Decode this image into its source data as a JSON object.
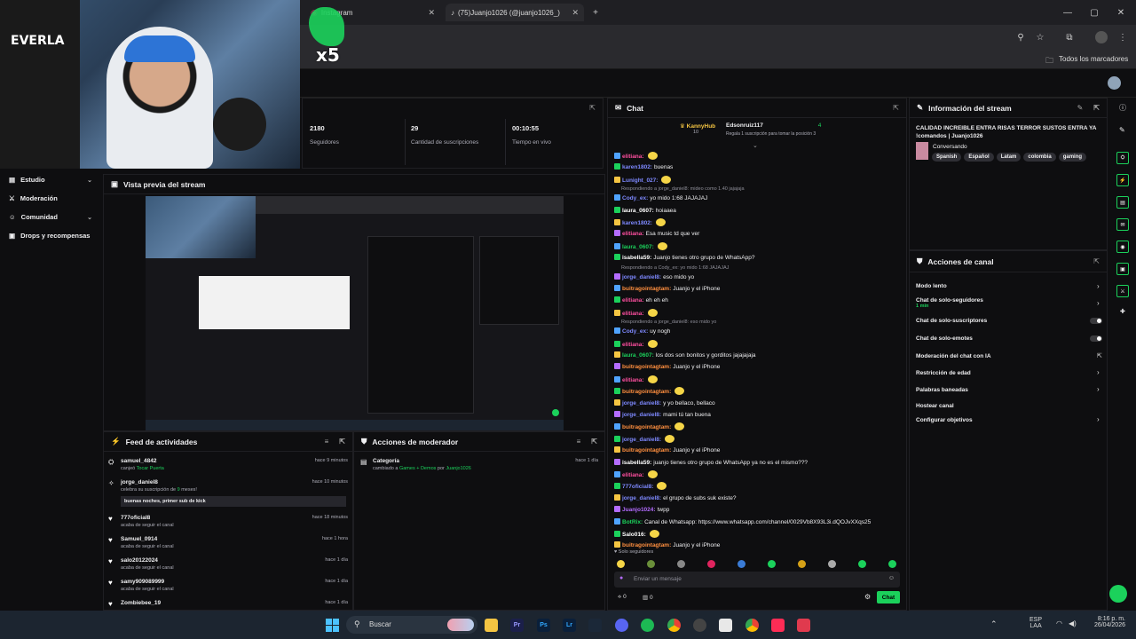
{
  "browser": {
    "tab1_title": "Instagram",
    "tab2_title": "(75)Juanjo1026 (@juanjo1026_)",
    "bookmarks_label": "Todos los marcadores"
  },
  "overlay": {
    "multiplier": "x5",
    "bag_text": "EVERLA"
  },
  "left_nav": {
    "items": [
      {
        "label": "Estudio"
      },
      {
        "label": "Moderación"
      },
      {
        "label": "Comunidad"
      },
      {
        "label": "Drops y recompensas"
      }
    ]
  },
  "stats": [
    {
      "value": "2180",
      "label": "Seguidores"
    },
    {
      "value": "29",
      "label": "Cantidad de suscripciones"
    },
    {
      "value": "00:10:55",
      "label": "Tiempo en vivo"
    }
  ],
  "preview": {
    "title": "Vista previa del stream"
  },
  "feed": {
    "title": "Feed de actividades",
    "items": [
      {
        "name": "samuel_4842",
        "sub": "canjeó",
        "sub_highlight": "Tocar Puerta",
        "time": "hace 9 minutos"
      },
      {
        "name": "jorge_daniel8",
        "sub": "celebra su suscripción de",
        "sub_months": "9",
        "sub_end": "meses!",
        "time": "hace 10 minutos",
        "message": "buenas noches, primer sub de kick"
      },
      {
        "name": "777oficial8",
        "sub": "acaba de seguir el canal",
        "time": "hace 18 minutos"
      },
      {
        "name": "Samuel_0914",
        "sub": "acaba de seguir el canal",
        "time": "hace 1 hora"
      },
      {
        "name": "salo20122024",
        "sub": "acaba de seguir el canal",
        "time": "hace 1 día"
      },
      {
        "name": "samy909089999",
        "sub": "acaba de seguir el canal",
        "time": "hace 1 día"
      },
      {
        "name": "Zombiebee_19",
        "sub": "",
        "time": "hace 1 día"
      }
    ]
  },
  "mod_actions": {
    "title": "Acciones de moderador",
    "item_title": "Categoría",
    "item_text": "cambiado a",
    "item_category": "Games + Demos",
    "item_by": "por",
    "item_user": "Juanjo1026",
    "item_time": "hace 1 día"
  },
  "chat": {
    "title": "Chat",
    "top_user1": "KannyHub",
    "top_user1_count": "10",
    "top_user2": "Edsonruiz117",
    "top_user2_count": "4",
    "top_note": "Regala 1 suscripción para tomar la posición 3",
    "lines": [
      {
        "user": "elitiana:",
        "text": "",
        "color": "#ff4fa0"
      },
      {
        "user": "karen1802:",
        "text": "buenas",
        "color": "#7e89ff"
      },
      {
        "user": "Lunight_027:",
        "text": "",
        "color": "#7e89ff"
      },
      {
        "reply": "Respondiendo a jorge_daniel8: mideo como 1.40 jajajaja"
      },
      {
        "user": "Cody_ex:",
        "text": "yo mido 1:68 JAJAJAJ",
        "color": "#7e89ff"
      },
      {
        "user": "laura_0607:",
        "text": "hoiaaea",
        "color": "#ffffff"
      },
      {
        "user": "karen1802:",
        "text": "",
        "color": "#7e89ff"
      },
      {
        "user": "elitiana:",
        "text": "Esa music td que ver",
        "color": "#ff4fa0"
      },
      {
        "user": "laura_0607:",
        "text": "",
        "color": "#1bd15b"
      },
      {
        "user": "isabella59:",
        "text": "Juanjo tienes otro grupo de WhatsApp?",
        "color": "#ffffff"
      },
      {
        "reply": "Respondiendo a Cody_ex: yo mido 1:68 JAJAJAJ"
      },
      {
        "user": "jorge_daniel8:",
        "text": "eso mido yo",
        "color": "#7e89ff"
      },
      {
        "user": "buitragointagtam:",
        "text": "Juanjo y el iPhone",
        "color": "#ff8f3f"
      },
      {
        "user": "elitiana:",
        "text": "eh eh eh",
        "color": "#ff4fa0"
      },
      {
        "user": "elitiana:",
        "text": "",
        "color": "#ff4fa0"
      },
      {
        "reply": "Respondiendo a jorge_daniel8: eso mido yo"
      },
      {
        "user": "Cody_ex:",
        "text": "uy nogh",
        "color": "#7e89ff"
      },
      {
        "user": "elitiana:",
        "text": "",
        "color": "#ff4fa0"
      },
      {
        "user": "laura_0607:",
        "text": "los dos son bonitos y gorditos jajajajaja",
        "color": "#1bd15b"
      },
      {
        "user": "buitragointagtam:",
        "text": "Juanjo y el iPhone",
        "color": "#ff8f3f"
      },
      {
        "user": "elitiana:",
        "text": "",
        "color": "#ff4fa0"
      },
      {
        "user": "buitragointagtam:",
        "text": "",
        "color": "#ff8f3f"
      },
      {
        "user": "jorge_daniel8:",
        "text": "y yo bellaco, bellaco",
        "color": "#7e89ff"
      },
      {
        "user": "jorge_daniel8:",
        "text": "mami tú tan buena",
        "color": "#7e89ff"
      },
      {
        "user": "buitragointagtam:",
        "text": "",
        "color": "#ff8f3f"
      },
      {
        "user": "jorge_daniel8:",
        "text": "",
        "color": "#7e89ff"
      },
      {
        "user": "buitragointagtam:",
        "text": "Juanjo y el iPhone",
        "color": "#ff8f3f"
      },
      {
        "user": "isabella59:",
        "text": "juanjo tienes otro grupo de WhatsApp ya no es el mismo???",
        "color": "#ffffff"
      },
      {
        "user": "elitiana:",
        "text": "",
        "color": "#ff4fa0"
      },
      {
        "user": "777oficial8:",
        "text": "",
        "color": "#7e89ff"
      },
      {
        "user": "jorge_daniel8:",
        "text": "el grupo de subs suk existe?",
        "color": "#7e89ff"
      },
      {
        "user": "Juanjo1024:",
        "text": "twpp",
        "color": "#b46cff"
      },
      {
        "user": "BotRix:",
        "text": "Canal de Whatsapp: https://www.whatsapp.com/channel/0029Vb8X93L3i.dQOJvXXqs25",
        "color": "#1bd15b"
      },
      {
        "user": "Salo016:",
        "text": "",
        "color": "#ffffff"
      },
      {
        "user": "buitragointagtam:",
        "text": "Juanjo y el iPhone",
        "color": "#ff8f3f"
      }
    ],
    "followers_only": "Solo seguidores",
    "input_placeholder": "Enviar un mensaje",
    "points": "0",
    "chat_count": "0",
    "send_label": "Chat"
  },
  "stream_info": {
    "title": "Información del stream",
    "stream_title": "CALIDAD INCREIBLE ENTRA RISAS TERROR SUSTOS ENTRA YA !comandos | Juanjo1026",
    "category": "Conversando",
    "tags": [
      "Spanish",
      "Español",
      "Latam",
      "colombia",
      "gaming"
    ]
  },
  "channel_actions": {
    "title": "Acciones de canal",
    "items": [
      {
        "label": "Modo lento",
        "control": "chevron"
      },
      {
        "label": "Chat de solo-seguidores",
        "sub": "1 min",
        "control": "chevron"
      },
      {
        "label": "Chat de solo-suscriptores",
        "control": "toggle"
      },
      {
        "label": "Chat de solo-emotes",
        "control": "toggle"
      },
      {
        "label": "Moderación del chat con IA",
        "control": "external"
      },
      {
        "label": "Restricción de edad",
        "control": "chevron"
      },
      {
        "label": "Palabras baneadas",
        "control": "chevron"
      },
      {
        "label": "Hostear canal",
        "control": "none"
      },
      {
        "label": "Configurar objetivos",
        "control": "chevron"
      }
    ]
  },
  "taskbar": {
    "search_placeholder": "Buscar",
    "lang": "ESP",
    "lang_sub": "LAA",
    "time": "8:16 p. m.",
    "date": "26/04/2026"
  },
  "colors": {
    "accent": "#1bd15b",
    "bg": "#0e0e10",
    "panel_border": "#1f1f23"
  }
}
